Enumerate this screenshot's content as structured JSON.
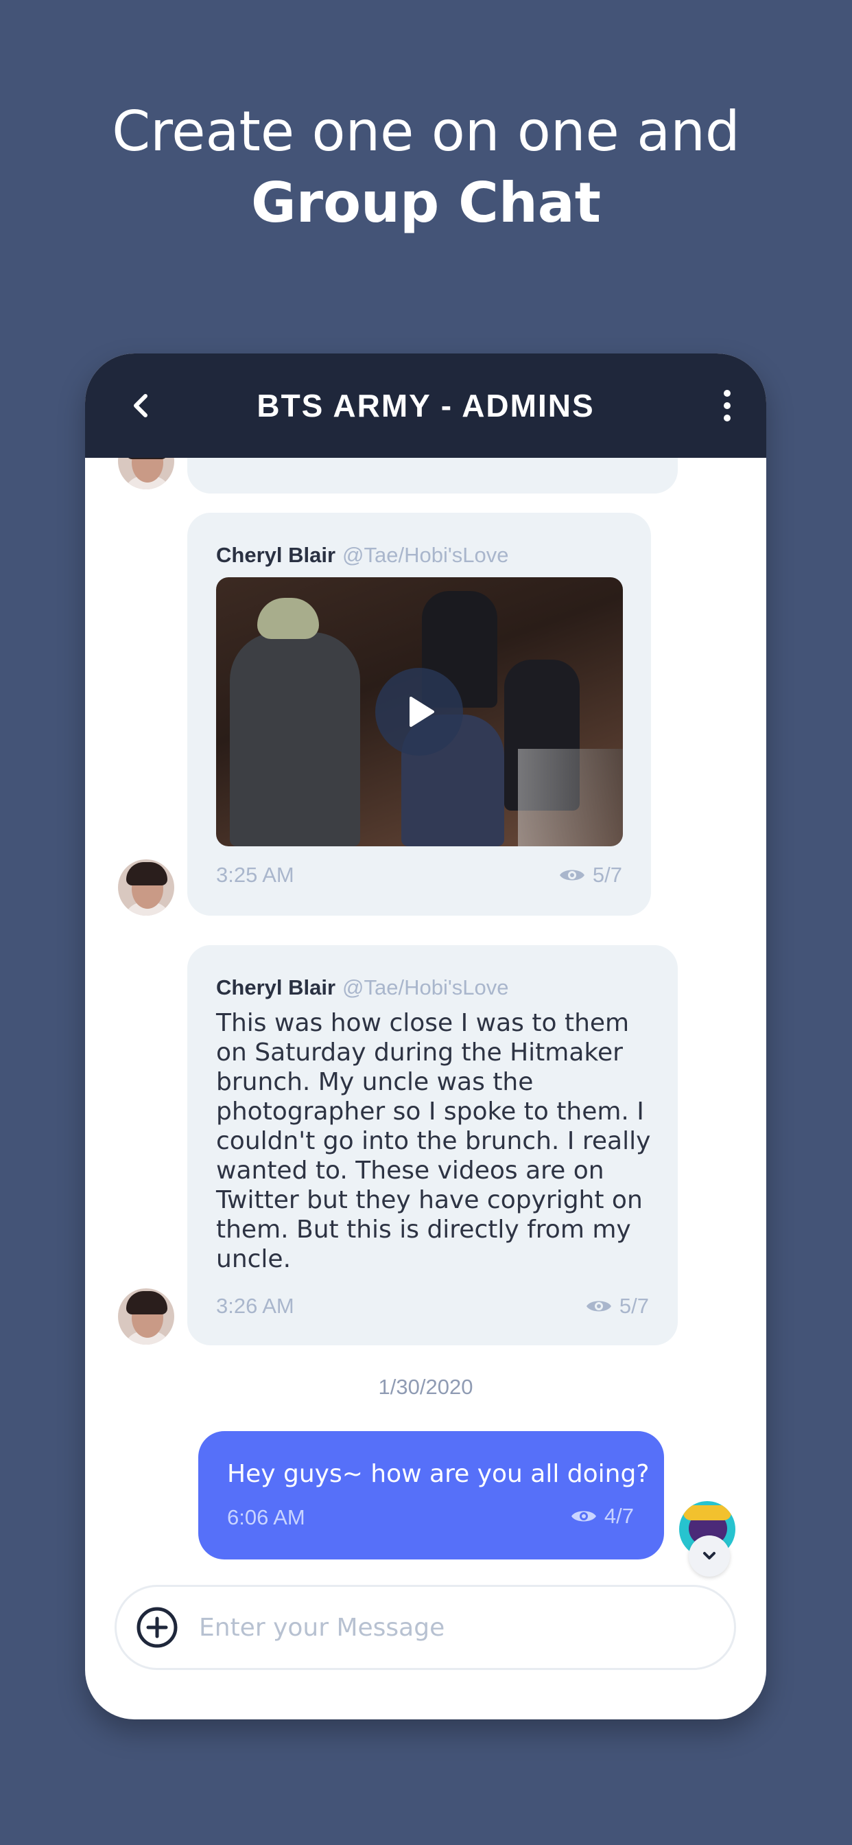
{
  "headline": {
    "line1": "Create one on one and",
    "line2": "Group Chat"
  },
  "chat": {
    "title": "BTS ARMY - ADMINS",
    "back_icon": "chevron-left-icon",
    "more_icon": "more-vertical-icon"
  },
  "messages": [
    {
      "sender": "Cheryl Blair",
      "handle": "@Tae/Hobi'sLove",
      "type": "video",
      "time": "3:25 AM",
      "seen": "5/7"
    },
    {
      "sender": "Cheryl Blair",
      "handle": "@Tae/Hobi'sLove",
      "type": "text",
      "text": "This was how close I was to them on Saturday during the Hitmaker brunch. My uncle was the photographer so I spoke to them. I couldn't go into the brunch. I really wanted to. These videos are on Twitter but they have copyright on them. But this is directly from my uncle.",
      "time": "3:26 AM",
      "seen": "5/7"
    }
  ],
  "date_separator": "1/30/2020",
  "outgoing": {
    "text": "Hey guys~ how are you all doing?",
    "time": "6:06 AM",
    "seen": "4/7"
  },
  "composer": {
    "placeholder": "Enter your Message",
    "value": ""
  },
  "colors": {
    "background": "#445477",
    "header": "#1f273b",
    "incoming_bubble": "#edf2f6",
    "outgoing_bubble": "#5670f9"
  }
}
